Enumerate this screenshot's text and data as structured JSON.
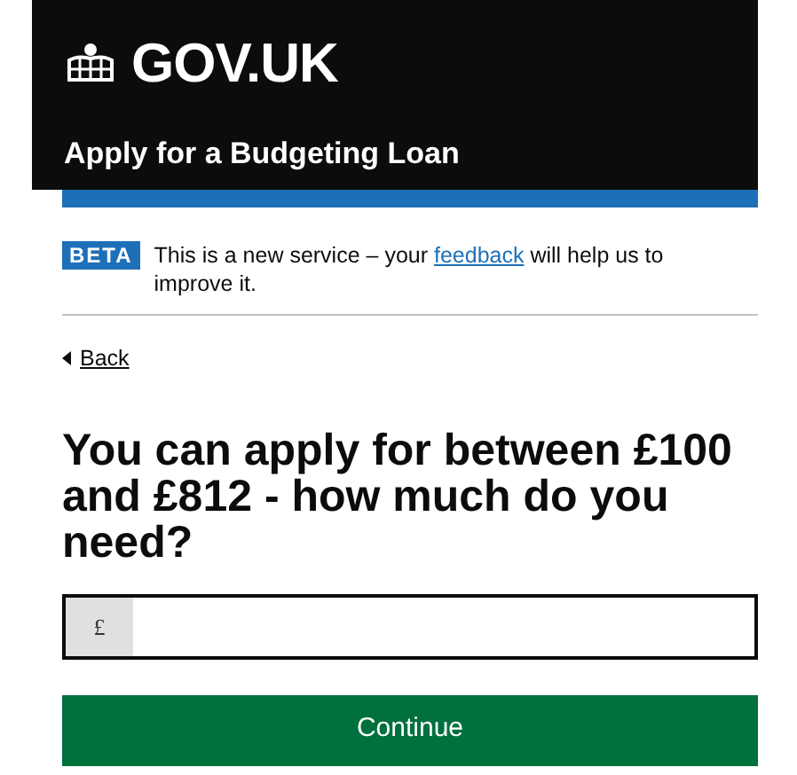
{
  "header": {
    "logo": "GOV.UK",
    "service_name": "Apply for a Budgeting Loan"
  },
  "phase_banner": {
    "tag": "BETA",
    "text_before": "This is a new service – your ",
    "link": "feedback",
    "text_after": " will help us to improve it."
  },
  "back_link": "Back",
  "question": "You can apply for between £100 and £812 - how much do you need?",
  "amount_field": {
    "prefix": "£"
  },
  "button": "Continue"
}
